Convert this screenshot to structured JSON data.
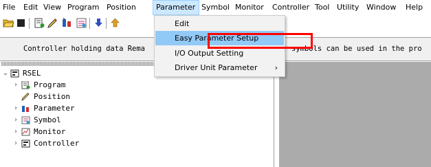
{
  "menubar": {
    "items": [
      "File",
      "Edit",
      "View",
      "Program",
      "Position",
      "Parameter",
      "Symbol",
      "Monitor",
      "Controller",
      "Tool",
      "Utility",
      "Window",
      "Help"
    ]
  },
  "toolbar": {
    "icons": [
      "open-folder-icon",
      "stop-icon",
      "program-icon",
      "position-icon",
      "parameter-icon",
      "symbol-icon",
      "download-icon",
      "upload-icon"
    ]
  },
  "message": {
    "left_text": "Controller holding data Rema",
    "right_text": "symbols can be used in the pro"
  },
  "tree": {
    "root": "RSEL",
    "children": [
      "Program",
      "Position",
      "Parameter",
      "Symbol",
      "Monitor",
      "Controller"
    ]
  },
  "dropdown": {
    "items": [
      "Edit",
      "Easy Parameter Setup",
      "I/O Output Setting",
      "Driver Unit Parameter"
    ],
    "submenu_arrow": "›"
  },
  "colors": {
    "highlight_outline": "#ff0000",
    "hover_background": "#91c9f7",
    "work_area": "#ababab"
  }
}
